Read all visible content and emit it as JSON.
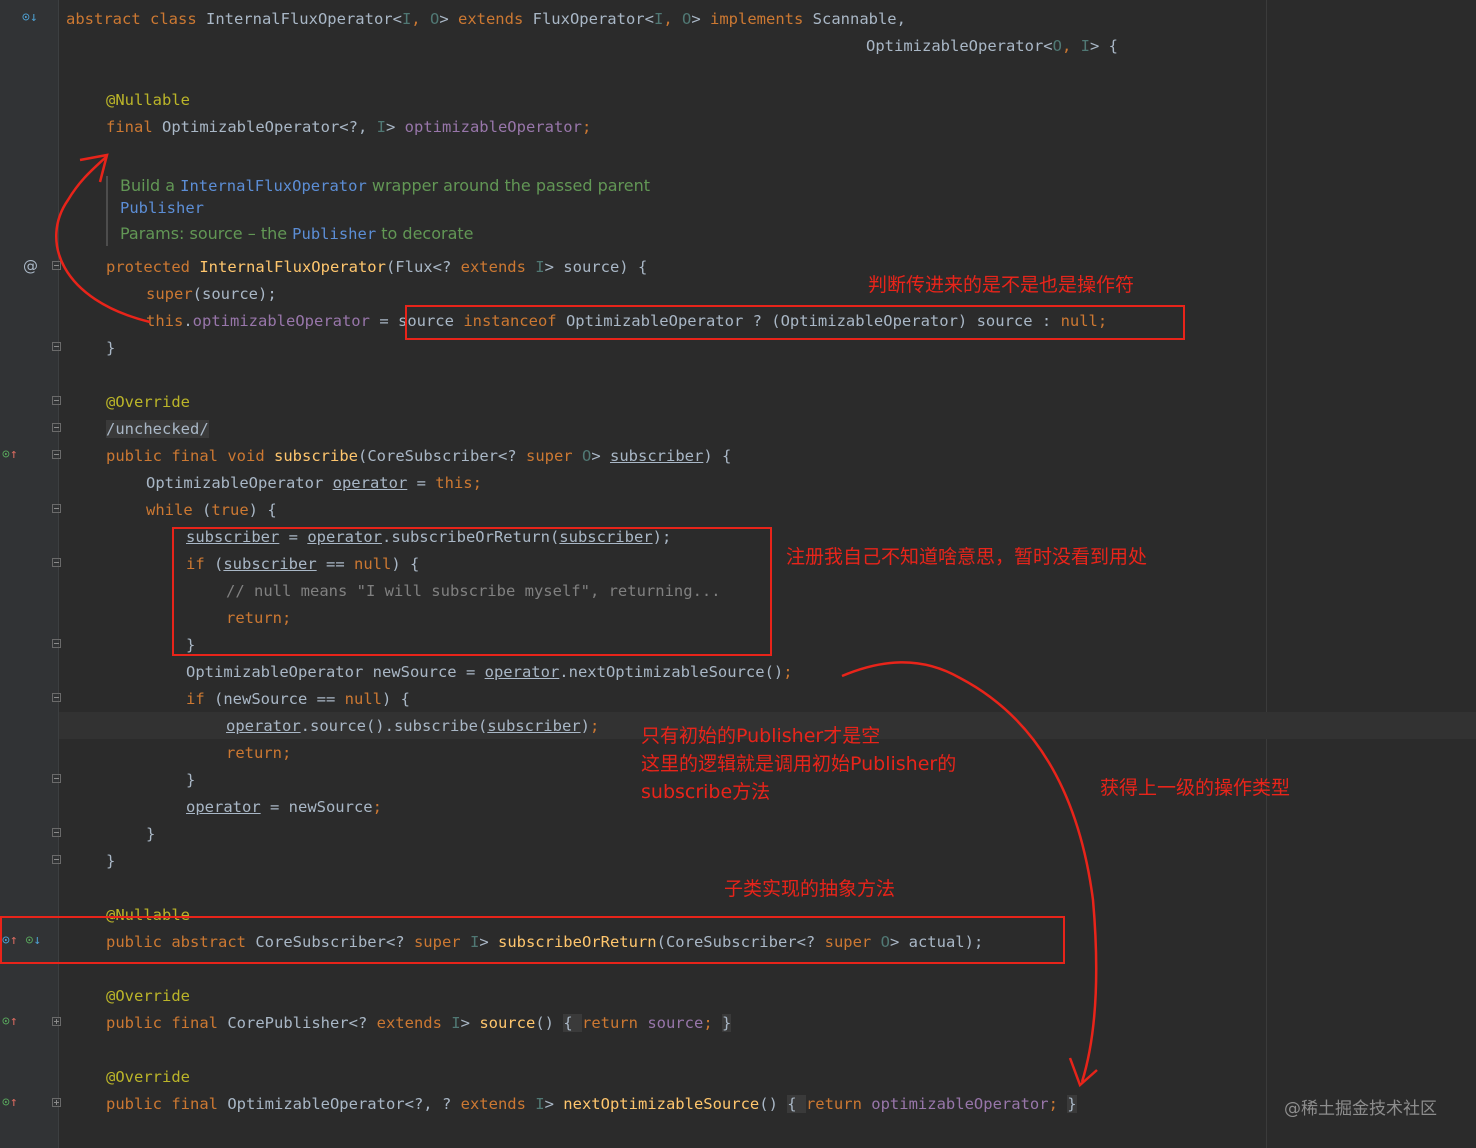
{
  "editor": {
    "lines": {
      "l1": {
        "a": "abstract class ",
        "b": "InternalFluxOperator<",
        "c": "I",
        "d": ", ",
        "e": "O",
        "f": "> ",
        "g": "extends ",
        "h": "FluxOperator<",
        "i": "I",
        "j": ", ",
        "k": "O",
        "l": "> ",
        "m": "implements ",
        "n": "Scannable,"
      },
      "l2": {
        "a": "OptimizableOperator<",
        "b": "O",
        "c": ", ",
        "d": "I",
        "e": "> {"
      },
      "l3": {
        "a": "@Nullable"
      },
      "l4": {
        "a": "final ",
        "b": "OptimizableOperator<?, ",
        "c": "I",
        "d": "> ",
        "e": "optimizableOperator",
        "f": ";"
      },
      "l5": {
        "a": "protected ",
        "b": "InternalFluxOperator",
        "c": "(Flux<? ",
        "d": "extends ",
        "e": "I",
        "f": "> source) {"
      },
      "l6": {
        "a": "super",
        "b": "(source);"
      },
      "l7": {
        "a": "this",
        "b": ".",
        "c": "optimizableOperator",
        " d": " = ",
        "e": "source ",
        "f": "instanceof ",
        "g": "OptimizableOperator ? (OptimizableOperator) source : ",
        "h": "null",
        "i": ";"
      },
      "l8": {
        "a": "}"
      },
      "l9": {
        "a": "@Override"
      },
      "l10": {
        "a": "/unchecked/"
      },
      "l11": {
        "a": "public ",
        "b": "final ",
        "c": "void ",
        "d": "subscribe",
        "e": "(CoreSubscriber<? ",
        "f": "super ",
        "g": "O",
        "h": "> ",
        "i": "subscriber",
        "j": ") {"
      },
      "l12": {
        "a": "OptimizableOperator ",
        "b": "operator",
        "c": " = ",
        "d": "this",
        "e": ";"
      },
      "l13": {
        "a": "while ",
        "b": "(",
        "c": "true",
        "d": ") {"
      },
      "l14": {
        "a": "subscriber",
        "b": " = ",
        "c": "operator",
        "d": ".subscribeOrReturn(",
        "e": "subscriber",
        "f": ");"
      },
      "l15": {
        "a": "if ",
        "b": "(",
        "c": "subscriber",
        "d": " == ",
        "e": "null",
        "f": ") {"
      },
      "l16": {
        "a": "// null means \"I will subscribe myself\", returning..."
      },
      "l17": {
        "a": "return",
        "b": ";"
      },
      "l18": {
        "a": "}"
      },
      "l19": {
        "a": "OptimizableOperator newSource = ",
        "b": "operator",
        "c": ".nextOptimizableSource()",
        "d": ";"
      },
      "l20": {
        "a": "if ",
        "b": "(newSource == ",
        "c": "null",
        "d": ") {"
      },
      "l21": {
        "a": "operator",
        "b": ".source().subscribe(",
        "c": "subscriber",
        "d": ")",
        "e": ";"
      },
      "l22": {
        "a": "return",
        "b": ";"
      },
      "l23": {
        "a": "}"
      },
      "l24": {
        "a": "operator",
        "b": " = newSource",
        "c": ";"
      },
      "l25": {
        "a": "}"
      },
      "l26": {
        "a": "}"
      },
      "l27": {
        "a": "@Nullable"
      },
      "l28": {
        "a": "public ",
        "b": "abstract ",
        "c": "CoreSubscriber<? ",
        "d": "super ",
        "e": "I",
        "f": "> ",
        "g": "subscribeOrReturn",
        "h": "(CoreSubscriber<? ",
        "i": "super ",
        "j": "O",
        "k": "> actual);"
      },
      "l29": {
        "a": "@Override"
      },
      "l30": {
        "a": "public ",
        "b": "final ",
        "c": "CorePublisher<? ",
        "d": "extends ",
        "e": "I",
        "f": "> ",
        "g": "source",
        "h": "() ",
        "i": "{ ",
        "j": "return ",
        "k": "source",
        "l": "; ",
        "m": "}"
      },
      "l31": {
        "a": "@Override"
      },
      "l32": {
        "a": "public ",
        "b": "final ",
        "c": "OptimizableOperator<?, ? ",
        "d": "extends ",
        "e": "I",
        "f": "> ",
        "g": "nextOptimizableSource",
        "h": "() ",
        "i": "{ ",
        "j": "return ",
        "k": "optimizableOperator",
        "l": "; ",
        "m": "}"
      }
    },
    "javadoc": {
      "line1_a": "Build a ",
      "line1_code": "InternalFluxOperator",
      "line1_b": " wrapper around the passed parent",
      "line2_code": "Publisher",
      "line3_a": "Params: source – the ",
      "line3_code": "Publisher",
      "line3_b": " to decorate"
    },
    "gutter_icons": {
      "implements_down": "⊙↓",
      "at": "@",
      "override_up": "⊙↑",
      "both": "⊙↑ ⊙↓"
    }
  },
  "annotations": {
    "note1": "判断传进来的是不是也是操作符",
    "note2": "注册我自己不知道啥意思，暂时没看到用处",
    "note3_l1": "只有初始的Publisher才是空",
    "note3_l2": "这里的逻辑就是调用初始Publisher的",
    "note3_l3": "subscribe方法",
    "note4": "获得上一级的操作类型",
    "note5": "子类实现的抽象方法",
    "color": "#e8241a"
  },
  "watermark": "@稀土掘金技术社区",
  "colors": {
    "background": "#2b2b2b",
    "gutter": "#313335",
    "keyword": "#cc7832",
    "annotation": "#bbb529",
    "field": "#9876aa",
    "type_param": "#507874",
    "method": "#ffc66d",
    "comment": "#808080",
    "javadoc": "#629755"
  }
}
